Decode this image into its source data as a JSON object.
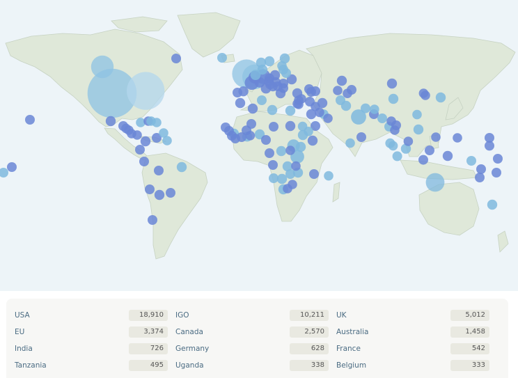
{
  "map": {
    "bubbles": [
      {
        "place": "USA",
        "lon": -98,
        "lat": 39,
        "value": 18910,
        "color": "#8ec3e3"
      },
      {
        "place": "Canada",
        "lon": -105,
        "lat": 58,
        "value": 2570,
        "color": "#8ec3e3"
      },
      {
        "place": "IGO",
        "lon": -73.9,
        "lat": 40.7,
        "value": 10211,
        "color": "#b3d7ec"
      },
      {
        "place": "UK",
        "lon": -1.5,
        "lat": 53,
        "value": 5012,
        "color": "#8ec3e3"
      },
      {
        "place": "EU",
        "lon": 4.4,
        "lat": 50.8,
        "value": 3374,
        "color": "#8ec3e3"
      },
      {
        "place": "Australia",
        "lon": 134,
        "lat": -25,
        "value": 1458,
        "color": "#7fb8de"
      },
      {
        "place": "India",
        "lon": 79,
        "lat": 22,
        "value": 726,
        "color": "#7fb8de"
      },
      {
        "place": "Germany",
        "lon": 10.5,
        "lat": 51,
        "value": 628,
        "color": "#6a86d6"
      },
      {
        "place": "France",
        "lon": 2.3,
        "lat": 46.5,
        "value": 542,
        "color": "#6a86d6"
      },
      {
        "place": "Tanzania",
        "lon": 35,
        "lat": -6.5,
        "value": 495,
        "color": "#7fb8de"
      },
      {
        "place": "Uganda",
        "lon": 32.3,
        "lat": 1.4,
        "value": 338,
        "color": "#7fb8de"
      },
      {
        "place": "Belgium",
        "lon": 4.5,
        "lat": 50.5,
        "value": 333,
        "color": "#6a86d6"
      },
      {
        "lon": -157,
        "lat": 20,
        "value": 80,
        "color": "#6a86d6"
      },
      {
        "lon": -170,
        "lat": -14,
        "value": 80,
        "color": "#6a86d6"
      },
      {
        "lon": -176,
        "lat": -18,
        "value": 80,
        "color": "#7fb8de"
      },
      {
        "lon": -52,
        "lat": 64,
        "value": 80,
        "color": "#6a86d6"
      },
      {
        "lon": -19,
        "lat": 64.5,
        "value": 80,
        "color": "#7fb8de"
      },
      {
        "lon": -99,
        "lat": 19,
        "value": 100,
        "color": "#6a86d6"
      },
      {
        "lon": -90,
        "lat": 15.5,
        "value": 80,
        "color": "#6a86d6"
      },
      {
        "lon": -88,
        "lat": 13.8,
        "value": 70,
        "color": "#6a86d6"
      },
      {
        "lon": -86,
        "lat": 12.5,
        "value": 70,
        "color": "#6a86d6"
      },
      {
        "lon": -84,
        "lat": 10,
        "value": 70,
        "color": "#6a86d6"
      },
      {
        "lon": -80,
        "lat": 9,
        "value": 70,
        "color": "#6a86d6"
      },
      {
        "lon": -77.5,
        "lat": 18,
        "value": 70,
        "color": "#7fb8de"
      },
      {
        "lon": -72,
        "lat": 19,
        "value": 70,
        "color": "#6a86d6"
      },
      {
        "lon": -70,
        "lat": 19,
        "value": 70,
        "color": "#7fb8de"
      },
      {
        "lon": -66,
        "lat": 18,
        "value": 70,
        "color": "#7fb8de"
      },
      {
        "lon": -61,
        "lat": 10.5,
        "value": 70,
        "color": "#7fb8de"
      },
      {
        "lon": -74,
        "lat": 4.5,
        "value": 100,
        "color": "#6a86d6"
      },
      {
        "lon": -66,
        "lat": 7,
        "value": 80,
        "color": "#6a86d6"
      },
      {
        "lon": -78,
        "lat": -1.5,
        "value": 80,
        "color": "#6a86d6"
      },
      {
        "lon": -58.5,
        "lat": 5,
        "value": 70,
        "color": "#7fb8de"
      },
      {
        "lon": -75,
        "lat": -10,
        "value": 80,
        "color": "#6a86d6"
      },
      {
        "lon": -64.5,
        "lat": -16.5,
        "value": 80,
        "color": "#6a86d6"
      },
      {
        "lon": -48,
        "lat": -14,
        "value": 100,
        "color": "#7fb8de"
      },
      {
        "lon": -71,
        "lat": -30,
        "value": 80,
        "color": "#6a86d6"
      },
      {
        "lon": -64,
        "lat": -34,
        "value": 100,
        "color": "#6a86d6"
      },
      {
        "lon": -56,
        "lat": -32.5,
        "value": 80,
        "color": "#6a86d6"
      },
      {
        "lon": -69,
        "lat": -52,
        "value": 80,
        "color": "#6a86d6"
      },
      {
        "lon": -3.7,
        "lat": 40.4,
        "value": 100,
        "color": "#6a86d6"
      },
      {
        "lon": -8,
        "lat": 39.5,
        "value": 80,
        "color": "#6a86d6"
      },
      {
        "lon": 8,
        "lat": 46.8,
        "value": 120,
        "color": "#6a86d6"
      },
      {
        "lon": 12.5,
        "lat": 42.5,
        "value": 120,
        "color": "#6a86d6"
      },
      {
        "lon": 5,
        "lat": 52.2,
        "value": 120,
        "color": "#7fb8de"
      },
      {
        "lon": 10,
        "lat": 56,
        "value": 100,
        "color": "#7fb8de"
      },
      {
        "lon": 15,
        "lat": 62,
        "value": 100,
        "color": "#7fb8de"
      },
      {
        "lon": 9,
        "lat": 61,
        "value": 100,
        "color": "#7fb8de"
      },
      {
        "lon": 26,
        "lat": 64,
        "value": 100,
        "color": "#7fb8de"
      },
      {
        "lon": 19,
        "lat": 52,
        "value": 100,
        "color": "#6a86d6"
      },
      {
        "lon": 15,
        "lat": 49.8,
        "value": 80,
        "color": "#6a86d6"
      },
      {
        "lon": 14.5,
        "lat": 47.5,
        "value": 80,
        "color": "#6a86d6"
      },
      {
        "lon": 19.5,
        "lat": 47,
        "value": 80,
        "color": "#6a86d6"
      },
      {
        "lon": 25,
        "lat": 46,
        "value": 80,
        "color": "#6a86d6"
      },
      {
        "lon": 21,
        "lat": 44,
        "value": 80,
        "color": "#6a86d6"
      },
      {
        "lon": 15.5,
        "lat": 45.2,
        "value": 70,
        "color": "#6a86d6"
      },
      {
        "lon": 17.5,
        "lat": 43.8,
        "value": 70,
        "color": "#6a86d6"
      },
      {
        "lon": 23,
        "lat": 39,
        "value": 100,
        "color": "#6a86d6"
      },
      {
        "lon": 25,
        "lat": 42.7,
        "value": 80,
        "color": "#6a86d6"
      },
      {
        "lon": 31,
        "lat": 49,
        "value": 100,
        "color": "#6a86d6"
      },
      {
        "lon": 25,
        "lat": 56,
        "value": 80,
        "color": "#7fb8de"
      },
      {
        "lon": 27,
        "lat": 53.5,
        "value": 80,
        "color": "#7fb8de"
      },
      {
        "lon": 24,
        "lat": 58.7,
        "value": 70,
        "color": "#7fb8de"
      },
      {
        "lon": 35,
        "lat": 39,
        "value": 100,
        "color": "#6a86d6"
      },
      {
        "lon": 43.5,
        "lat": 42,
        "value": 80,
        "color": "#6a86d6"
      },
      {
        "lon": 45,
        "lat": 40,
        "value": 80,
        "color": "#6a86d6"
      },
      {
        "lon": 48,
        "lat": 40.5,
        "value": 80,
        "color": "#6a86d6"
      },
      {
        "lon": 36,
        "lat": 34,
        "value": 70,
        "color": "#6a86d6"
      },
      {
        "lon": 35,
        "lat": 31.5,
        "value": 70,
        "color": "#6a86d6"
      },
      {
        "lon": 36,
        "lat": 31,
        "value": 70,
        "color": "#6a86d6"
      },
      {
        "lon": 38,
        "lat": 35,
        "value": 70,
        "color": "#6a86d6"
      },
      {
        "lon": 44,
        "lat": 33,
        "value": 80,
        "color": "#6a86d6"
      },
      {
        "lon": 53,
        "lat": 32,
        "value": 100,
        "color": "#6a86d6"
      },
      {
        "lon": 45,
        "lat": 24,
        "value": 100,
        "color": "#6a86d6"
      },
      {
        "lon": 48,
        "lat": 29.5,
        "value": 70,
        "color": "#6a86d6"
      },
      {
        "lon": 54,
        "lat": 24,
        "value": 70,
        "color": "#7fb8de"
      },
      {
        "lon": 51,
        "lat": 25.3,
        "value": 70,
        "color": "#6a86d6"
      },
      {
        "lon": 57,
        "lat": 21,
        "value": 70,
        "color": "#6a86d6"
      },
      {
        "lon": 48,
        "lat": 15.5,
        "value": 80,
        "color": "#6a86d6"
      },
      {
        "lon": 67,
        "lat": 48,
        "value": 100,
        "color": "#6a86d6"
      },
      {
        "lon": 64,
        "lat": 41,
        "value": 70,
        "color": "#6a86d6"
      },
      {
        "lon": 74,
        "lat": 41.5,
        "value": 80,
        "color": "#6a86d6"
      },
      {
        "lon": 71,
        "lat": 38.9,
        "value": 70,
        "color": "#6a86d6"
      },
      {
        "lon": 66,
        "lat": 34,
        "value": 80,
        "color": "#7fb8de"
      },
      {
        "lon": 70,
        "lat": 30,
        "value": 100,
        "color": "#7fb8de"
      },
      {
        "lon": 84,
        "lat": 28.2,
        "value": 80,
        "color": "#7fb8de"
      },
      {
        "lon": 90.4,
        "lat": 27.5,
        "value": 70,
        "color": "#7fb8de"
      },
      {
        "lon": 90,
        "lat": 24,
        "value": 80,
        "color": "#6a86d6"
      },
      {
        "lon": 96,
        "lat": 21,
        "value": 80,
        "color": "#7fb8de"
      },
      {
        "lon": 101,
        "lat": 15,
        "value": 80,
        "color": "#7fb8de"
      },
      {
        "lon": 102.5,
        "lat": 19,
        "value": 70,
        "color": "#6a86d6"
      },
      {
        "lon": 105,
        "lat": 12.5,
        "value": 70,
        "color": "#6a86d6"
      },
      {
        "lon": 106,
        "lat": 16,
        "value": 80,
        "color": "#6a86d6"
      },
      {
        "lon": 81,
        "lat": 7.5,
        "value": 80,
        "color": "#6a86d6"
      },
      {
        "lon": 73,
        "lat": 3.2,
        "value": 70,
        "color": "#7fb8de"
      },
      {
        "lon": 104,
        "lat": 35,
        "value": 100,
        "color": "#7fb8de"
      },
      {
        "lon": 103,
        "lat": 46,
        "value": 100,
        "color": "#6a86d6"
      },
      {
        "lon": 127,
        "lat": 37.5,
        "value": 70,
        "color": "#6a86d6"
      },
      {
        "lon": 125.7,
        "lat": 39,
        "value": 70,
        "color": "#6a86d6"
      },
      {
        "lon": 138,
        "lat": 36,
        "value": 100,
        "color": "#7fb8de"
      },
      {
        "lon": 121,
        "lat": 23.7,
        "value": 70,
        "color": "#7fb8de"
      },
      {
        "lon": 122,
        "lat": 13,
        "value": 100,
        "color": "#7fb8de"
      },
      {
        "lon": 101.7,
        "lat": 3.1,
        "value": 80,
        "color": "#7fb8de"
      },
      {
        "lon": 103.8,
        "lat": 1.3,
        "value": 70,
        "color": "#7fb8de"
      },
      {
        "lon": 113,
        "lat": -0.8,
        "value": 100,
        "color": "#7fb8de"
      },
      {
        "lon": 106.8,
        "lat": -6.2,
        "value": 80,
        "color": "#7fb8de"
      },
      {
        "lon": 114.7,
        "lat": 4.5,
        "value": 70,
        "color": "#6a86d6"
      },
      {
        "lon": 125.5,
        "lat": -8.8,
        "value": 80,
        "color": "#6a86d6"
      },
      {
        "lon": 130,
        "lat": -2,
        "value": 80,
        "color": "#6a86d6"
      },
      {
        "lon": 143,
        "lat": -6,
        "value": 100,
        "color": "#6a86d6"
      },
      {
        "lon": 150,
        "lat": 7,
        "value": 70,
        "color": "#6a86d6"
      },
      {
        "lon": 134.5,
        "lat": 7.5,
        "value": 70,
        "color": "#6a86d6"
      },
      {
        "lon": 160,
        "lat": -9.5,
        "value": 80,
        "color": "#7fb8de"
      },
      {
        "lon": 167,
        "lat": -15.5,
        "value": 80,
        "color": "#6a86d6"
      },
      {
        "lon": 178,
        "lat": -18,
        "value": 80,
        "color": "#6a86d6"
      },
      {
        "lon": 173,
        "lat": 7,
        "value": 80,
        "color": "#6a86d6"
      },
      {
        "lon": 173,
        "lat": 1.3,
        "value": 80,
        "color": "#6a86d6"
      },
      {
        "lon": 179,
        "lat": -8,
        "value": 80,
        "color": "#6a86d6"
      },
      {
        "lon": 175,
        "lat": -41,
        "value": 100,
        "color": "#7fb8de"
      },
      {
        "lon": 166,
        "lat": -21.5,
        "value": 80,
        "color": "#6a86d6"
      },
      {
        "lon": -6,
        "lat": 32,
        "value": 100,
        "color": "#6a86d6"
      },
      {
        "lon": 3,
        "lat": 28,
        "value": 100,
        "color": "#6a86d6"
      },
      {
        "lon": 9.5,
        "lat": 34,
        "value": 80,
        "color": "#7fb8de"
      },
      {
        "lon": 17,
        "lat": 27,
        "value": 100,
        "color": "#7fb8de"
      },
      {
        "lon": 30,
        "lat": 26.5,
        "value": 100,
        "color": "#7fb8de"
      },
      {
        "lon": 30,
        "lat": 15.5,
        "value": 100,
        "color": "#6a86d6"
      },
      {
        "lon": 39,
        "lat": 9,
        "value": 100,
        "color": "#7fb8de"
      },
      {
        "lon": 38.8,
        "lat": 15.2,
        "value": 70,
        "color": "#7fb8de"
      },
      {
        "lon": 43,
        "lat": 11.6,
        "value": 70,
        "color": "#7fb8de"
      },
      {
        "lon": 46,
        "lat": 5,
        "value": 100,
        "color": "#6a86d6"
      },
      {
        "lon": -16.5,
        "lat": 14.5,
        "value": 80,
        "color": "#6a86d6"
      },
      {
        "lon": -14,
        "lat": 12,
        "value": 80,
        "color": "#6a86d6"
      },
      {
        "lon": -10.5,
        "lat": 10,
        "value": 100,
        "color": "#7fb8de"
      },
      {
        "lon": -12,
        "lat": 8.5,
        "value": 80,
        "color": "#6a86d6"
      },
      {
        "lon": -9.5,
        "lat": 6.5,
        "value": 80,
        "color": "#6a86d6"
      },
      {
        "lon": -5,
        "lat": 7.5,
        "value": 80,
        "color": "#6a86d6"
      },
      {
        "lon": -1.5,
        "lat": 12.4,
        "value": 80,
        "color": "#6a86d6"
      },
      {
        "lon": -1,
        "lat": 7.9,
        "value": 100,
        "color": "#7fb8de"
      },
      {
        "lon": 1.2,
        "lat": 8.6,
        "value": 70,
        "color": "#6a86d6"
      },
      {
        "lon": 8,
        "lat": 9.5,
        "value": 100,
        "color": "#7fb8de"
      },
      {
        "lon": 2,
        "lat": 17,
        "value": 80,
        "color": "#6a86d6"
      },
      {
        "lon": 18,
        "lat": 15,
        "value": 80,
        "color": "#6a86d6"
      },
      {
        "lon": 12.5,
        "lat": 5.5,
        "value": 80,
        "color": "#6a86d6"
      },
      {
        "lon": 15,
        "lat": -4,
        "value": 80,
        "color": "#6a86d6"
      },
      {
        "lon": 23.5,
        "lat": -2.5,
        "value": 100,
        "color": "#7fb8de"
      },
      {
        "lon": 30,
        "lat": -2,
        "value": 70,
        "color": "#6a86d6"
      },
      {
        "lon": 37.5,
        "lat": 0.5,
        "value": 100,
        "color": "#7fb8de"
      },
      {
        "lon": 17.5,
        "lat": -12.5,
        "value": 80,
        "color": "#6a86d6"
      },
      {
        "lon": 28,
        "lat": -13.5,
        "value": 100,
        "color": "#7fb8de"
      },
      {
        "lon": 34,
        "lat": -13.3,
        "value": 70,
        "color": "#6a86d6"
      },
      {
        "lon": 35.5,
        "lat": -18,
        "value": 100,
        "color": "#7fb8de"
      },
      {
        "lon": 30,
        "lat": -19,
        "value": 80,
        "color": "#7fb8de"
      },
      {
        "lon": 18,
        "lat": -22,
        "value": 80,
        "color": "#7fb8de"
      },
      {
        "lon": 24,
        "lat": -22.5,
        "value": 100,
        "color": "#7fb8de"
      },
      {
        "lon": 25,
        "lat": -30,
        "value": 100,
        "color": "#7fb8de"
      },
      {
        "lon": 28,
        "lat": -29.5,
        "value": 70,
        "color": "#6a86d6"
      },
      {
        "lon": 31.5,
        "lat": -26.5,
        "value": 70,
        "color": "#6a86d6"
      },
      {
        "lon": 47,
        "lat": -19,
        "value": 80,
        "color": "#6a86d6"
      },
      {
        "lon": 57.5,
        "lat": -20.3,
        "value": 70,
        "color": "#7fb8de"
      }
    ]
  },
  "stats_table": {
    "rows": [
      [
        {
          "name": "USA",
          "value": "18,910"
        },
        {
          "name": "IGO",
          "value": "10,211"
        },
        {
          "name": "UK",
          "value": "5,012"
        }
      ],
      [
        {
          "name": "EU",
          "value": "3,374"
        },
        {
          "name": "Canada",
          "value": "2,570"
        },
        {
          "name": "Australia",
          "value": "1,458"
        }
      ],
      [
        {
          "name": "India",
          "value": "726"
        },
        {
          "name": "Germany",
          "value": "628"
        },
        {
          "name": "France",
          "value": "542"
        }
      ],
      [
        {
          "name": "Tanzania",
          "value": "495"
        },
        {
          "name": "Uganda",
          "value": "338"
        },
        {
          "name": "Belgium",
          "value": "333"
        }
      ]
    ]
  }
}
